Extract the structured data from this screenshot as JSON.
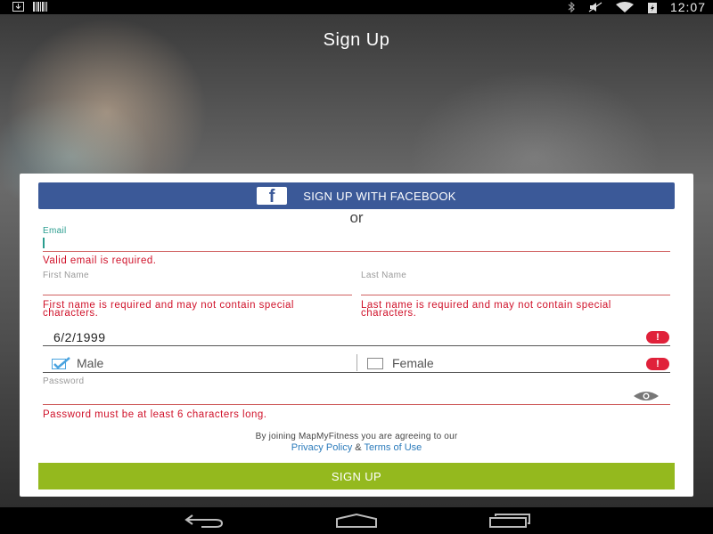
{
  "status_bar": {
    "time": "12:07"
  },
  "screen": {
    "title": "Sign Up"
  },
  "facebook": {
    "label": "SIGN UP WITH FACEBOOK",
    "logo": "f"
  },
  "divider_text": "or",
  "email": {
    "label": "Email",
    "value": "",
    "error": "Valid email is required."
  },
  "first_name": {
    "placeholder": "First Name",
    "error": "First name is required and may not contain special characters."
  },
  "last_name": {
    "placeholder": "Last Name",
    "error": "Last name is required and may not contain special characters."
  },
  "birthdate": {
    "value": "6/2/1999"
  },
  "gender": {
    "male_label": "Male",
    "female_label": "Female",
    "selected": "Male"
  },
  "password": {
    "placeholder": "Password",
    "error": "Password must be at least 6 characters long."
  },
  "terms": {
    "text": "By joining MapMyFitness you are agreeing to our",
    "privacy_link": "Privacy Policy",
    "amp": "&",
    "terms_link": "Terms of Use"
  },
  "signup_button": {
    "label": "SIGN UP"
  },
  "colors": {
    "facebook_blue": "#3b5998",
    "signup_green": "#94b91e",
    "error_red": "#d0122a",
    "accent_teal": "#2a9d8f",
    "link_blue": "#2b7bbb"
  },
  "icons": [
    "download-icon",
    "barcode-icon",
    "bluetooth-icon",
    "mute-icon",
    "wifi-icon",
    "battery-icon",
    "back-icon",
    "home-icon",
    "recents-icon",
    "facebook-icon",
    "alert-icon",
    "check-icon",
    "eye-icon"
  ]
}
